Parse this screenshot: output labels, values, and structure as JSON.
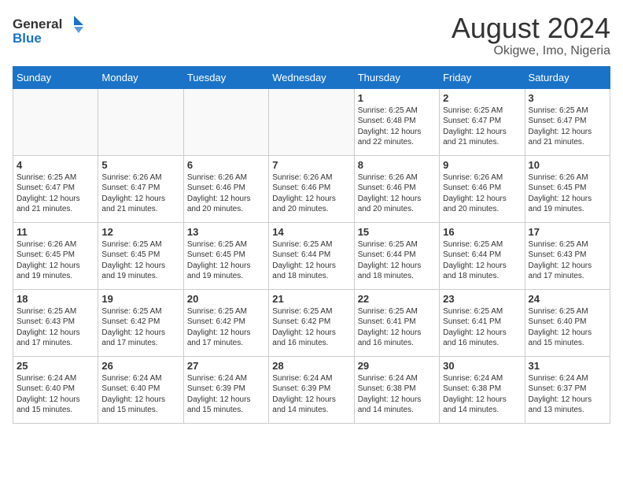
{
  "logo": {
    "line1": "General",
    "line2": "Blue"
  },
  "title": "August 2024",
  "location": "Okigwe, Imo, Nigeria",
  "weekdays": [
    "Sunday",
    "Monday",
    "Tuesday",
    "Wednesday",
    "Thursday",
    "Friday",
    "Saturday"
  ],
  "weeks": [
    [
      {
        "day": "",
        "info": ""
      },
      {
        "day": "",
        "info": ""
      },
      {
        "day": "",
        "info": ""
      },
      {
        "day": "",
        "info": ""
      },
      {
        "day": "1",
        "info": "Sunrise: 6:25 AM\nSunset: 6:48 PM\nDaylight: 12 hours\nand 22 minutes."
      },
      {
        "day": "2",
        "info": "Sunrise: 6:25 AM\nSunset: 6:47 PM\nDaylight: 12 hours\nand 21 minutes."
      },
      {
        "day": "3",
        "info": "Sunrise: 6:25 AM\nSunset: 6:47 PM\nDaylight: 12 hours\nand 21 minutes."
      }
    ],
    [
      {
        "day": "4",
        "info": "Sunrise: 6:25 AM\nSunset: 6:47 PM\nDaylight: 12 hours\nand 21 minutes."
      },
      {
        "day": "5",
        "info": "Sunrise: 6:26 AM\nSunset: 6:47 PM\nDaylight: 12 hours\nand 21 minutes."
      },
      {
        "day": "6",
        "info": "Sunrise: 6:26 AM\nSunset: 6:46 PM\nDaylight: 12 hours\nand 20 minutes."
      },
      {
        "day": "7",
        "info": "Sunrise: 6:26 AM\nSunset: 6:46 PM\nDaylight: 12 hours\nand 20 minutes."
      },
      {
        "day": "8",
        "info": "Sunrise: 6:26 AM\nSunset: 6:46 PM\nDaylight: 12 hours\nand 20 minutes."
      },
      {
        "day": "9",
        "info": "Sunrise: 6:26 AM\nSunset: 6:46 PM\nDaylight: 12 hours\nand 20 minutes."
      },
      {
        "day": "10",
        "info": "Sunrise: 6:26 AM\nSunset: 6:45 PM\nDaylight: 12 hours\nand 19 minutes."
      }
    ],
    [
      {
        "day": "11",
        "info": "Sunrise: 6:26 AM\nSunset: 6:45 PM\nDaylight: 12 hours\nand 19 minutes."
      },
      {
        "day": "12",
        "info": "Sunrise: 6:25 AM\nSunset: 6:45 PM\nDaylight: 12 hours\nand 19 minutes."
      },
      {
        "day": "13",
        "info": "Sunrise: 6:25 AM\nSunset: 6:45 PM\nDaylight: 12 hours\nand 19 minutes."
      },
      {
        "day": "14",
        "info": "Sunrise: 6:25 AM\nSunset: 6:44 PM\nDaylight: 12 hours\nand 18 minutes."
      },
      {
        "day": "15",
        "info": "Sunrise: 6:25 AM\nSunset: 6:44 PM\nDaylight: 12 hours\nand 18 minutes."
      },
      {
        "day": "16",
        "info": "Sunrise: 6:25 AM\nSunset: 6:44 PM\nDaylight: 12 hours\nand 18 minutes."
      },
      {
        "day": "17",
        "info": "Sunrise: 6:25 AM\nSunset: 6:43 PM\nDaylight: 12 hours\nand 17 minutes."
      }
    ],
    [
      {
        "day": "18",
        "info": "Sunrise: 6:25 AM\nSunset: 6:43 PM\nDaylight: 12 hours\nand 17 minutes."
      },
      {
        "day": "19",
        "info": "Sunrise: 6:25 AM\nSunset: 6:42 PM\nDaylight: 12 hours\nand 17 minutes."
      },
      {
        "day": "20",
        "info": "Sunrise: 6:25 AM\nSunset: 6:42 PM\nDaylight: 12 hours\nand 17 minutes."
      },
      {
        "day": "21",
        "info": "Sunrise: 6:25 AM\nSunset: 6:42 PM\nDaylight: 12 hours\nand 16 minutes."
      },
      {
        "day": "22",
        "info": "Sunrise: 6:25 AM\nSunset: 6:41 PM\nDaylight: 12 hours\nand 16 minutes."
      },
      {
        "day": "23",
        "info": "Sunrise: 6:25 AM\nSunset: 6:41 PM\nDaylight: 12 hours\nand 16 minutes."
      },
      {
        "day": "24",
        "info": "Sunrise: 6:25 AM\nSunset: 6:40 PM\nDaylight: 12 hours\nand 15 minutes."
      }
    ],
    [
      {
        "day": "25",
        "info": "Sunrise: 6:24 AM\nSunset: 6:40 PM\nDaylight: 12 hours\nand 15 minutes."
      },
      {
        "day": "26",
        "info": "Sunrise: 6:24 AM\nSunset: 6:40 PM\nDaylight: 12 hours\nand 15 minutes."
      },
      {
        "day": "27",
        "info": "Sunrise: 6:24 AM\nSunset: 6:39 PM\nDaylight: 12 hours\nand 15 minutes."
      },
      {
        "day": "28",
        "info": "Sunrise: 6:24 AM\nSunset: 6:39 PM\nDaylight: 12 hours\nand 14 minutes."
      },
      {
        "day": "29",
        "info": "Sunrise: 6:24 AM\nSunset: 6:38 PM\nDaylight: 12 hours\nand 14 minutes."
      },
      {
        "day": "30",
        "info": "Sunrise: 6:24 AM\nSunset: 6:38 PM\nDaylight: 12 hours\nand 14 minutes."
      },
      {
        "day": "31",
        "info": "Sunrise: 6:24 AM\nSunset: 6:37 PM\nDaylight: 12 hours\nand 13 minutes."
      }
    ]
  ]
}
